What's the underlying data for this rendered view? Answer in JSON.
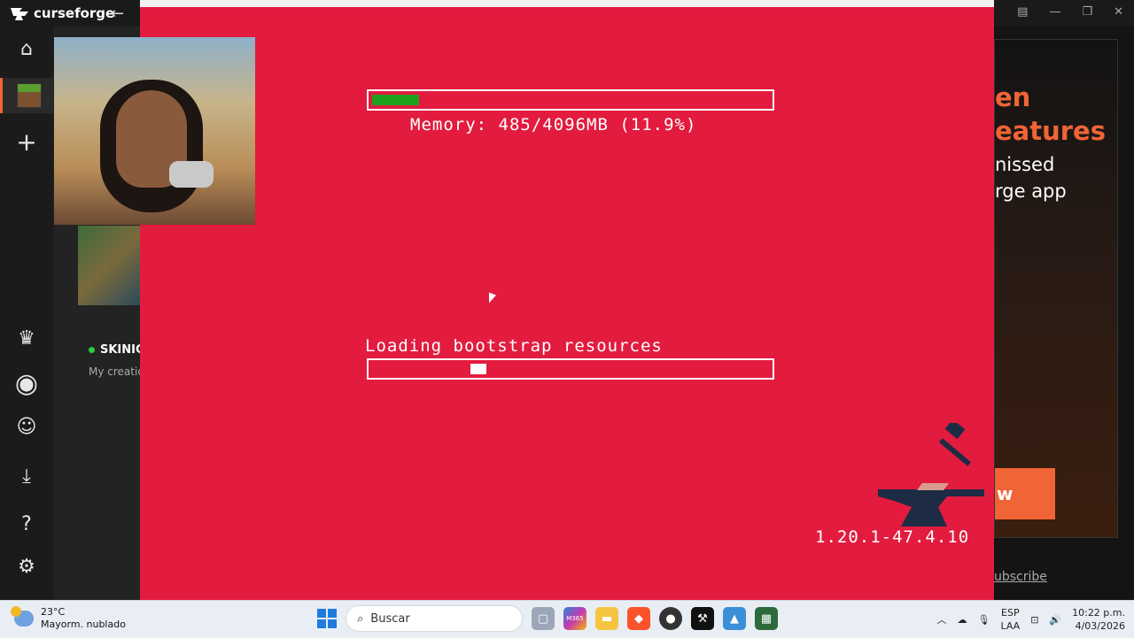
{
  "app": {
    "name": "curseforge"
  },
  "sidebar": {
    "items": [
      {
        "name": "home",
        "glyph": "⌂"
      },
      {
        "name": "minecraft",
        "glyph": ""
      },
      {
        "name": "add",
        "glyph": "+"
      },
      {
        "name": "premium",
        "glyph": "♛"
      },
      {
        "name": "profile",
        "glyph": "◉"
      },
      {
        "name": "discord",
        "glyph": "☺"
      },
      {
        "name": "downloads",
        "glyph": "⤓"
      },
      {
        "name": "help",
        "glyph": "?"
      },
      {
        "name": "settings",
        "glyph": "⚙"
      }
    ]
  },
  "panel": {
    "skin_name": "SKINIC",
    "subtitle": "My creatio"
  },
  "loading": {
    "memory_text": "Memory: 485/4096MB (11.9%)",
    "memory_fraction": 0.119,
    "status_text": "Loading bootstrap resources",
    "progress_fraction": 0.25,
    "version": "1.20.1-47.4.10",
    "memory_bar_color": "#1ea21e",
    "background_color": "#e21b3f"
  },
  "ad": {
    "line1": "en",
    "line2": "eatures",
    "line3": "nissed",
    "line4": "rge app",
    "button": "w",
    "subscribe": "ubscribe",
    "accent_color": "#f16436"
  },
  "taskbar": {
    "weather_temp": "23°C",
    "weather_desc": "Mayorm. nublado",
    "search_placeholder": "Buscar",
    "lang1": "ESP",
    "lang2": "LAA",
    "time": "10:22 p.m.",
    "date": "4/03/2026",
    "app_labels": [
      "M365"
    ]
  }
}
